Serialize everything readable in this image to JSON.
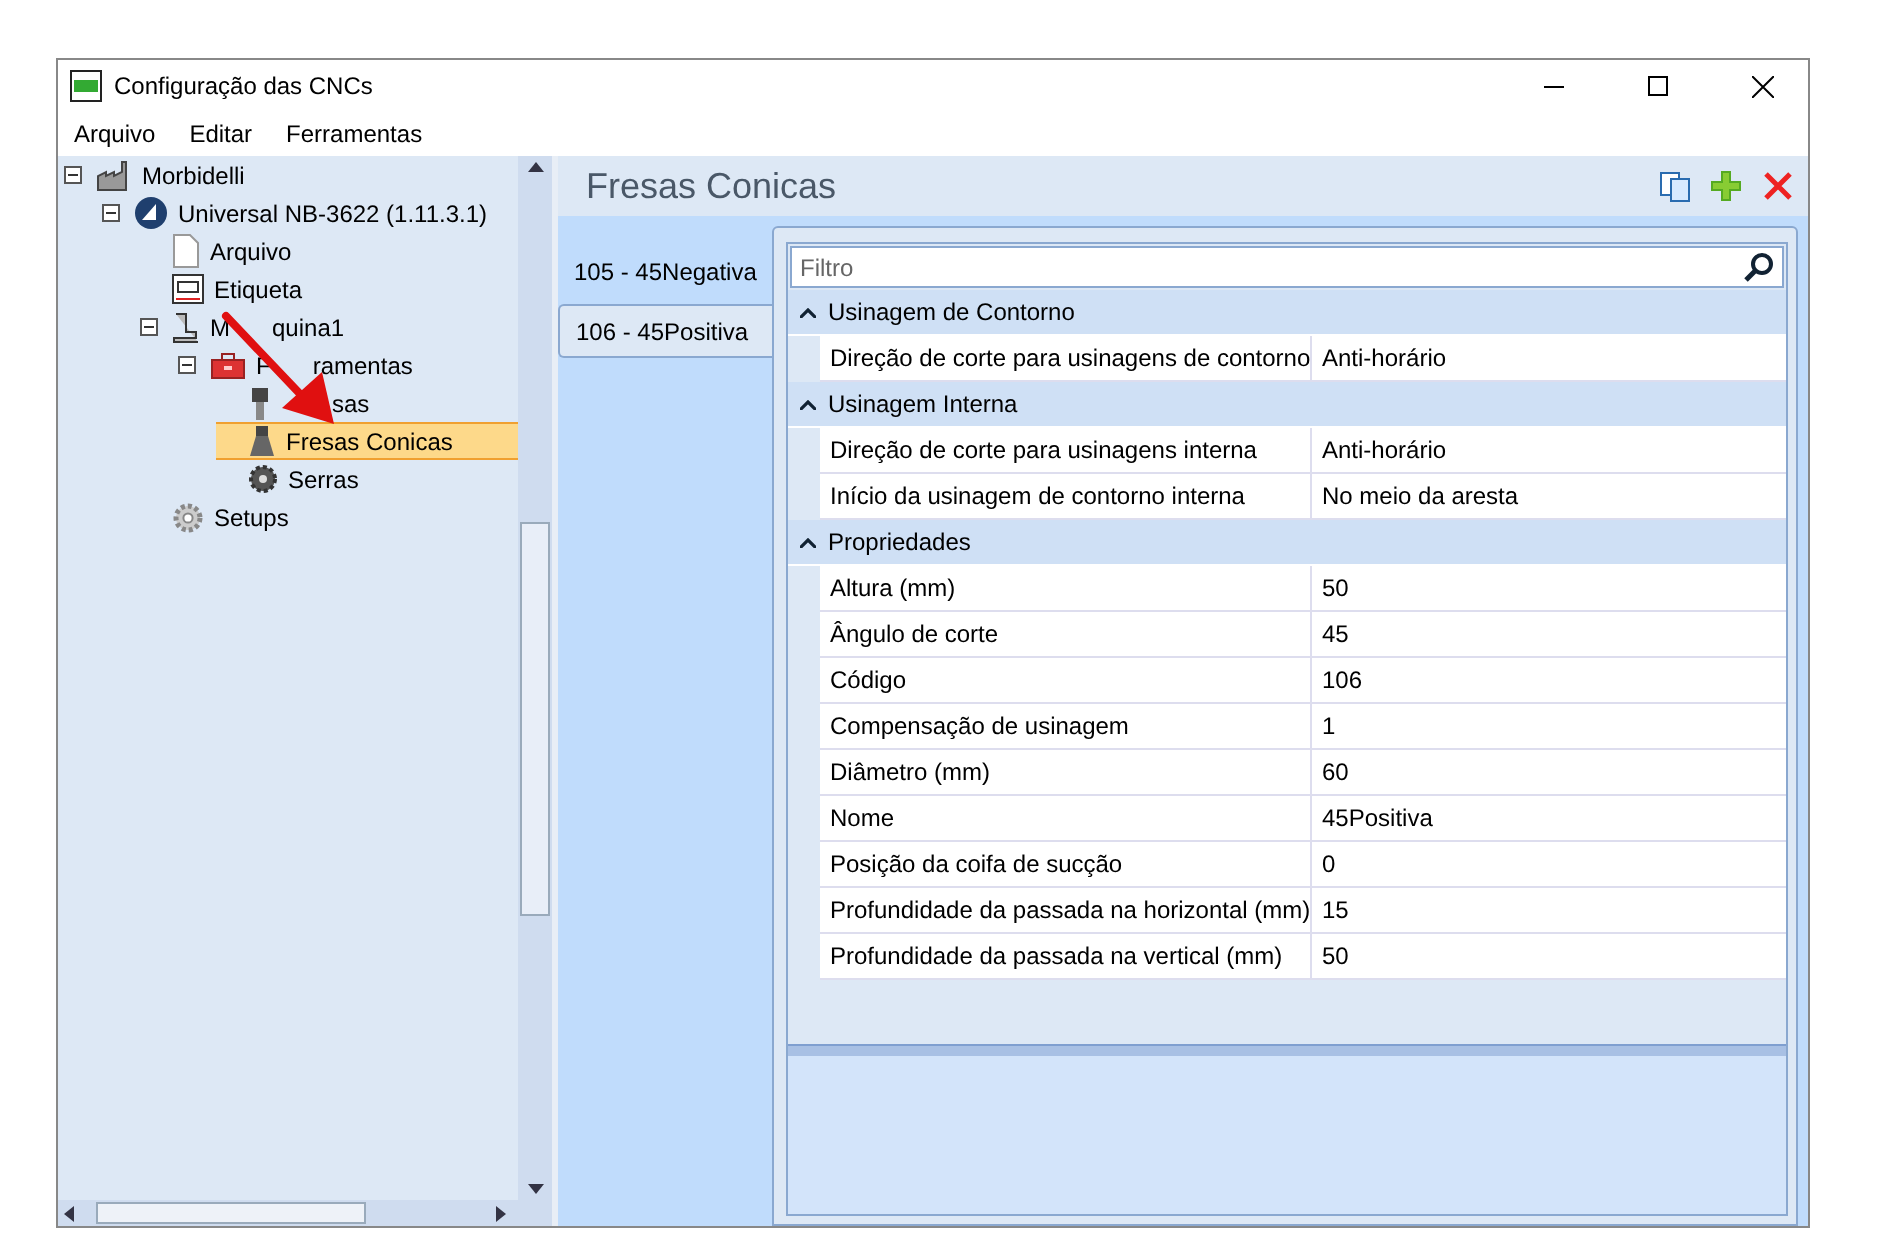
{
  "window": {
    "title": "Configuração das CNCs"
  },
  "menu": [
    "Arquivo",
    "Editar",
    "Ferramentas"
  ],
  "tree": [
    {
      "label": "Morbidelli",
      "kind": "factory",
      "expanded": true,
      "selected": false,
      "children": [
        {
          "label": "Universal NB-3622 (1.11.3.1)",
          "kind": "machine-logo",
          "expanded": true,
          "selected": false,
          "children": [
            {
              "label": "Arquivo",
              "kind": "file",
              "selected": false
            },
            {
              "label": "Etiqueta",
              "kind": "label",
              "selected": false
            },
            {
              "label_fragments": [
                "M",
                "quina1"
              ],
              "kind": "machine",
              "expanded": true,
              "selected": false,
              "children": [
                {
                  "label_fragments": [
                    "F",
                    "ramentas"
                  ],
                  "kind": "toolbox",
                  "expanded": true,
                  "selected": false,
                  "children": [
                    {
                      "label_fragments": [
                        "sas"
                      ],
                      "kind": "mill",
                      "selected": false
                    },
                    {
                      "label": "Fresas Conicas",
                      "kind": "cone",
                      "selected": true
                    },
                    {
                      "label": "Serras",
                      "kind": "saw",
                      "selected": false
                    }
                  ]
                }
              ]
            },
            {
              "label": "Setups",
              "kind": "gear",
              "selected": false
            }
          ]
        }
      ]
    }
  ],
  "panel": {
    "title": "Fresas Conicas"
  },
  "tabs": [
    {
      "label": "105 - 45Negativa",
      "selected": false
    },
    {
      "label": "106 - 45Positiva",
      "selected": true
    }
  ],
  "filter": {
    "placeholder": "Filtro"
  },
  "categories": [
    {
      "title": "Usinagem de Contorno",
      "expanded": true,
      "rows": [
        {
          "name": "Direção de corte para usinagens de contorno",
          "value": "Anti-horário"
        }
      ]
    },
    {
      "title": "Usinagem Interna",
      "expanded": true,
      "rows": [
        {
          "name": "Direção de corte para usinagens interna",
          "value": "Anti-horário"
        },
        {
          "name": "Início da usinagem de contorno interna",
          "value": "No meio da aresta"
        }
      ]
    },
    {
      "title": "Propriedades",
      "expanded": true,
      "rows": [
        {
          "name": "Altura (mm)",
          "value": "50"
        },
        {
          "name": "Ângulo de corte",
          "value": "45"
        },
        {
          "name": "Código",
          "value": "106"
        },
        {
          "name": "Compensação de usinagem",
          "value": "1"
        },
        {
          "name": "Diâmetro (mm)",
          "value": "60"
        },
        {
          "name": "Nome",
          "value": "45Positiva"
        },
        {
          "name": "Posição da coifa de sucção",
          "value": "0"
        },
        {
          "name": "Profundidade da passada na horizontal (mm)",
          "value": "15"
        },
        {
          "name": "Profundidade da passada na vertical (mm)",
          "value": "50"
        }
      ]
    }
  ]
}
